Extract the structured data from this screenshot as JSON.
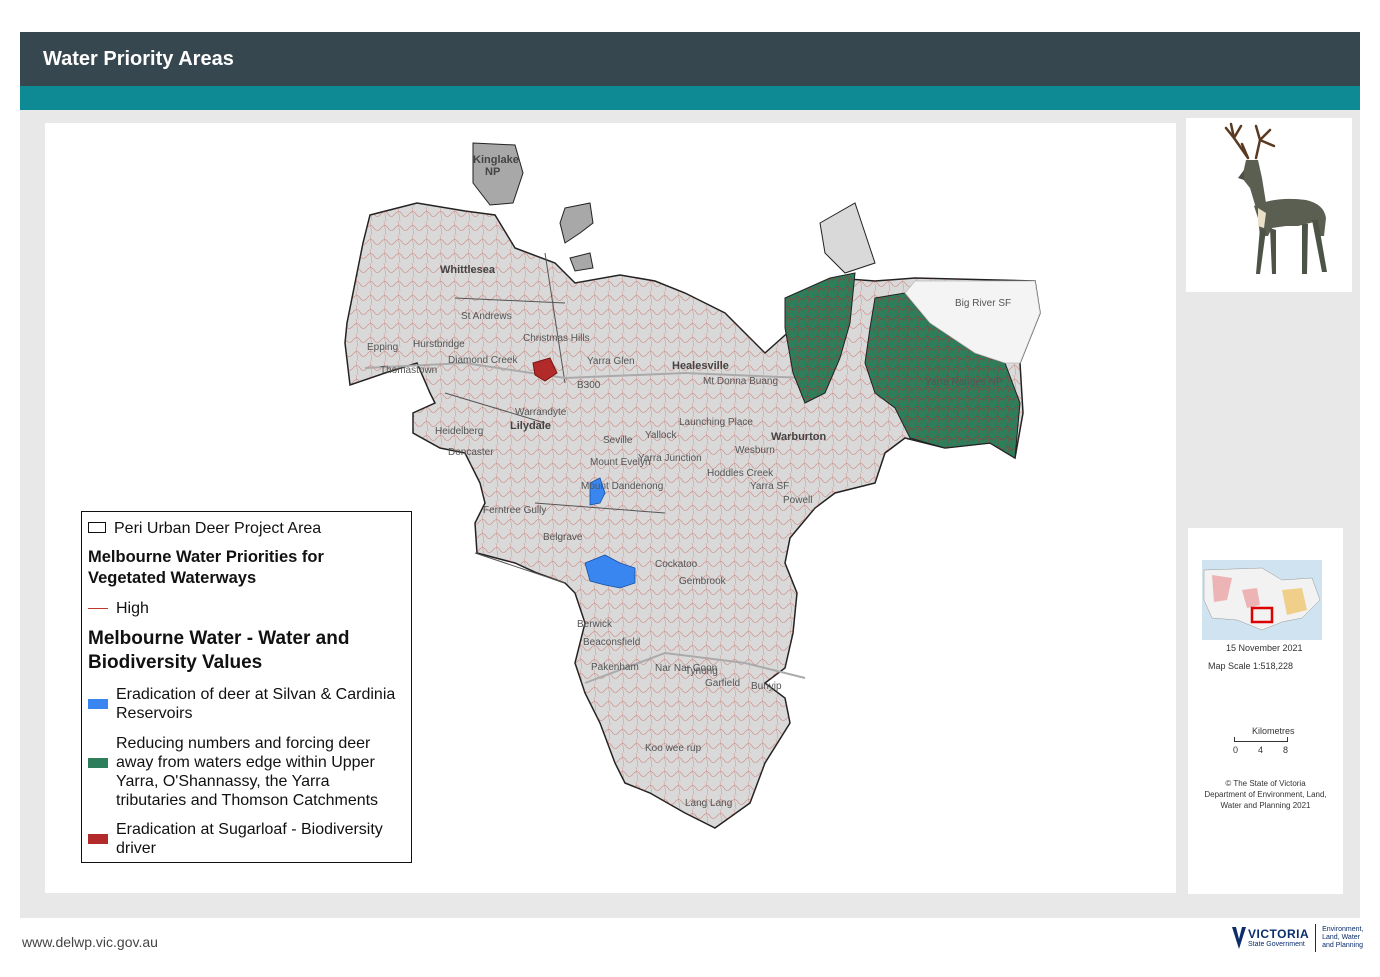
{
  "header": {
    "title": "Water Priority Areas"
  },
  "colors": {
    "header_bg": "#37474f",
    "accent_bar": "#0e8a95",
    "silvan_cardinia": "#3a86f0",
    "upper_yarra": "#2e7d5b",
    "sugarloaf": "#b22a2a",
    "waterways": "#c0392b",
    "project_area_fill": "#d9d9d9"
  },
  "legend": {
    "project_area": "Peri Urban Deer Project Area",
    "section1_title": "Melbourne Water Priorities for Vegetated Waterways",
    "high_label": "High",
    "section2_title": "Melbourne Water - Water and Biodiversity Values",
    "items": [
      {
        "label": "Eradication of deer at Silvan & Cardinia Reservoirs",
        "color": "#3a86f0"
      },
      {
        "label": "Reducing numbers and forcing deer away from waters edge within Upper Yarra, O'Shannassy, the Yarra tributaries and Thomson Catchments",
        "color": "#2e7d5b"
      },
      {
        "label": "Eradication at Sugarloaf - Biodiversity driver",
        "color": "#b22a2a"
      }
    ]
  },
  "map_labels": {
    "kinglake": "Kinglake",
    "np": "NP",
    "whittlesea": "Whittlesea",
    "st_andrews": "St Andrews",
    "christmas_hills": "Christmas Hills",
    "hurstbridge": "Hurstbridge",
    "diamond_creek": "Diamond Creek",
    "epping": "Epping",
    "thomastown": "Thomastown",
    "yarra_glen": "Yarra Glen",
    "healesville": "Healesville",
    "mt_donna_buang": "Mt Donna Buang",
    "warrandyte": "Warrandyte",
    "lilydale": "Lilydale",
    "heidelberg": "Heidelberg",
    "doncaster": "Doncaster",
    "seville": "Seville",
    "wandin_yallock": "Yallock",
    "launching_place": "Launching Place",
    "warburton": "Warburton",
    "wesburn": "Wesburn",
    "mount_evelyn": "Mount Evelyn",
    "yarra_junction": "Yarra Junction",
    "hoddles_creek": "Hoddles Creek",
    "yarra_sf": "Yarra SF",
    "mount_dandenong": "Mount Dandenong",
    "powelltown": "Powell",
    "ferntree_gully": "Ferntree Gully",
    "belgrave": "Belgrave",
    "cockatoo": "Cockatoo",
    "gembrook": "Gembrook",
    "beaconsfield": "Beaconsfield",
    "berwick": "Berwick",
    "pakenham": "Pakenham",
    "nar_nar_goon": "Nar Nar Goon",
    "tynong": "Tynong",
    "garfield": "Garfield",
    "bunyip": "Bunyip",
    "koo_wee_rup": "Koo wee rup",
    "lang_lang": "Lang Lang",
    "big_river_sf": "Big River SF",
    "yarra_ranges_np": "Yarra Ranges NP",
    "b300": "B300"
  },
  "info": {
    "date": "15 November 2021",
    "map_scale": "Map Scale  1:518,228",
    "km_label": "Kilometres",
    "ticks": [
      "0",
      "4",
      "8"
    ],
    "copyright1": "© The State of Victoria",
    "copyright2": "Department of Environment, Land,",
    "copyright3": "Water and Planning  2021"
  },
  "footer": {
    "url": "www.delwp.vic.gov.au",
    "logo_word": "VICTORIA",
    "logo_sub": "State Government",
    "dept1": "Environment,",
    "dept2": "Land, Water",
    "dept3": "and Planning"
  }
}
